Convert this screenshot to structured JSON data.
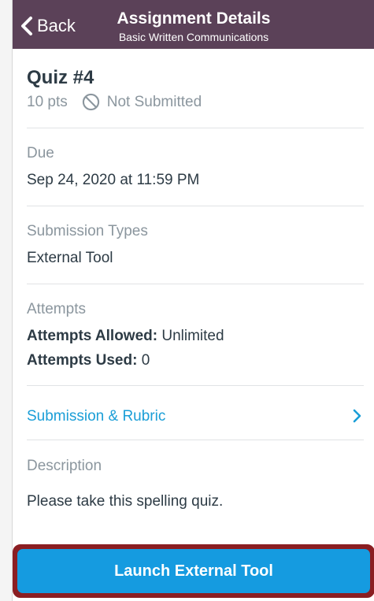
{
  "navbar": {
    "back_label": "Back",
    "title": "Assignment Details",
    "subtitle": "Basic Written Communications",
    "background": "#5b4158"
  },
  "assignment": {
    "title": "Quiz #4",
    "points": "10 pts",
    "submission_status": "Not Submitted"
  },
  "due": {
    "label": "Due",
    "value": "Sep 24, 2020 at 11:59 PM"
  },
  "submission_types": {
    "label": "Submission Types",
    "value": "External Tool"
  },
  "attempts": {
    "label": "Attempts",
    "allowed_label": "Attempts Allowed:",
    "allowed_value": "Unlimited",
    "used_label": "Attempts Used:",
    "used_value": "0"
  },
  "submission_rubric": {
    "label": "Submission & Rubric",
    "color": "#1a9ed7"
  },
  "description": {
    "label": "Description",
    "text": "Please take this spelling quiz."
  },
  "launch": {
    "label": "Launch External Tool",
    "color": "#159be0",
    "highlight_color": "#8b1e22"
  },
  "icons": {
    "back": "chevron-left-icon",
    "status": "no-entry-icon",
    "rubric": "chevron-right-icon"
  }
}
